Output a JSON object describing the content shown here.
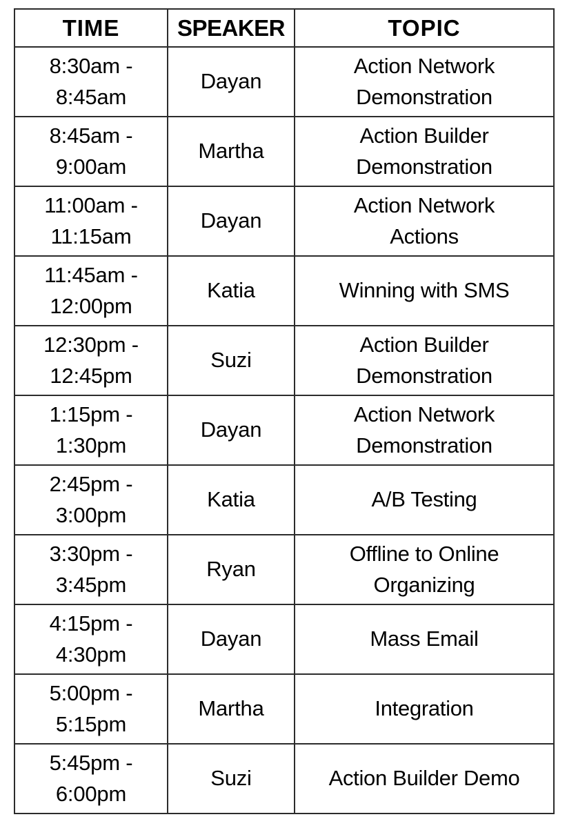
{
  "table": {
    "columns": [
      {
        "key": "time",
        "label": "TIME"
      },
      {
        "key": "speaker",
        "label": "SPEAKER"
      },
      {
        "key": "topic",
        "label": "TOPIC"
      }
    ],
    "rows": [
      {
        "time_line1": "8:30am -",
        "time_line2": "8:45am",
        "speaker": "Dayan",
        "topic_line1": "Action Network",
        "topic_line2": "Demonstration"
      },
      {
        "time_line1": "8:45am -",
        "time_line2": "9:00am",
        "speaker": "Martha",
        "topic_line1": "Action Builder",
        "topic_line2": "Demonstration"
      },
      {
        "time_line1": "11:00am -",
        "time_line2": "11:15am",
        "speaker": "Dayan",
        "topic_line1": "Action Network",
        "topic_line2": "Actions"
      },
      {
        "time_line1": "11:45am -",
        "time_line2": "12:00pm",
        "speaker": "Katia",
        "topic_line1": "Winning with SMS",
        "topic_line2": ""
      },
      {
        "time_line1": "12:30pm -",
        "time_line2": "12:45pm",
        "speaker": "Suzi",
        "topic_line1": "Action Builder",
        "topic_line2": "Demonstration"
      },
      {
        "time_line1": "1:15pm -",
        "time_line2": "1:30pm",
        "speaker": "Dayan",
        "topic_line1": "Action Network",
        "topic_line2": "Demonstration"
      },
      {
        "time_line1": "2:45pm -",
        "time_line2": "3:00pm",
        "speaker": "Katia",
        "topic_line1": "A/B Testing",
        "topic_line2": ""
      },
      {
        "time_line1": "3:30pm -",
        "time_line2": "3:45pm",
        "speaker": "Ryan",
        "topic_line1": "Offline to Online",
        "topic_line2": "Organizing"
      },
      {
        "time_line1": "4:15pm -",
        "time_line2": "4:30pm",
        "speaker": "Dayan",
        "topic_line1": "Mass Email",
        "topic_line2": ""
      },
      {
        "time_line1": "5:00pm -",
        "time_line2": "5:15pm",
        "speaker": "Martha",
        "topic_line1": "Integration",
        "topic_line2": ""
      },
      {
        "time_line1": "5:45pm -",
        "time_line2": "6:00pm",
        "speaker": "Suzi",
        "topic_line1": "Action Builder Demo",
        "topic_line2": ""
      }
    ]
  },
  "colors": {
    "border": "#2b2b2b",
    "text": "#000000",
    "background": "#ffffff"
  }
}
